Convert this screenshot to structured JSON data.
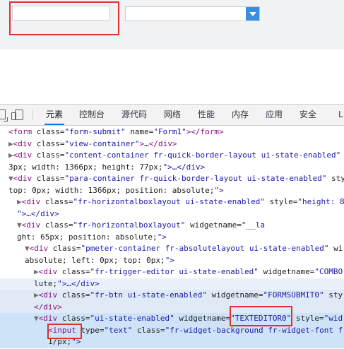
{
  "preview": {
    "text_input": {
      "value": "",
      "placeholder": ""
    },
    "combo": {
      "value": ""
    },
    "highlight_color": "#e03131"
  },
  "devtools": {
    "tabs": [
      "元素",
      "控制台",
      "源代码",
      "网络",
      "性能",
      "内存",
      "应用",
      "安全",
      "L"
    ],
    "active_tab": "元素",
    "accent": "#1a73e8",
    "dom_lines": [
      "<form class=\"form-submit\" name=\"Form1\"></form>",
      "▶<div class=\"view-container\">…</div>",
      "▶<div class=\"content-container fr-quick-border-layout ui-state-enabled\"",
      "3px; width: 1366px; height: 77px;\">…</div>",
      "▼<div class=\"para-container fr-quick-border-layout ui-state-enabled\" sty",
      "top: 0px; width: 1366px; position: absolute;\">",
      "  ▶<div class=\"fr-horizontalboxlayout ui-state-enabled\" style=\"height: 8",
      "  \">…</div>",
      "  ▼<div class=\"fr-horizontalboxlayout\" widgetname=\"__la",
      "  ght: 65px; position: absolute;\">",
      "    ▼<div class=\"pmeter-container fr-absolutelayout ui-state-enabled\" wi",
      "    absolute; left: 0px; top: 0px;\">",
      "      ▶<div class=\"fr-trigger-editor ui-state-enabled\" widgetname=\"COMBO",
      "      lute;\">…</div>",
      "      ▶<div class=\"fr-btn ui-state-enabled\" widgetname=\"FORMSUBMIT0\" sty",
      "      </div>",
      "      ▼<div class=\"ui-state-enabled\" widgetname=\"TEXTEDITOR0\" style=\"wid",
      "        <input type=\"text\" class=\"fr-widget-background fr-widget-font f",
      "        1/px;\">"
    ]
  }
}
